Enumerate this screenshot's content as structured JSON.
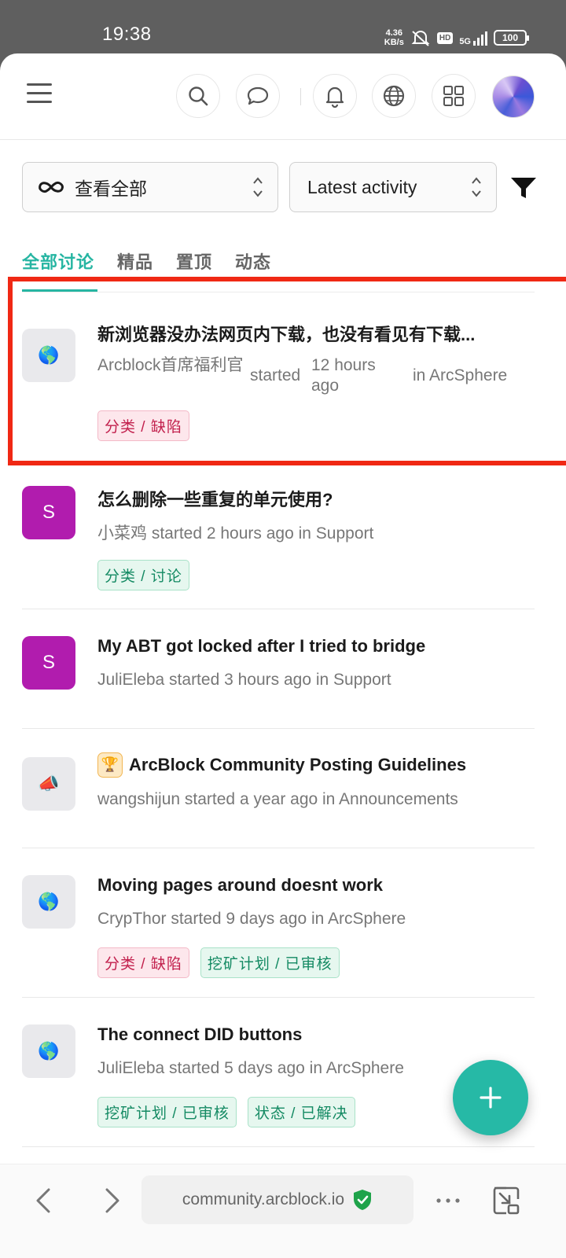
{
  "status_bar": {
    "time": "19:38",
    "net_speed_value": "4.36",
    "net_speed_unit": "KB/s",
    "hd": "HD",
    "network": "5G",
    "battery": "100"
  },
  "header": {
    "icons": [
      "menu-icon",
      "search-icon",
      "chat-icon",
      "bell-icon",
      "globe-icon",
      "apps-grid-icon",
      "user-avatar"
    ]
  },
  "filters": {
    "scope_label": "查看全部",
    "sort_label": "Latest activity"
  },
  "tabs": [
    {
      "label": "全部讨论",
      "active": true
    },
    {
      "label": "精品",
      "active": false
    },
    {
      "label": "置顶",
      "active": false
    },
    {
      "label": "动态",
      "active": false
    }
  ],
  "topics": [
    {
      "title": "新浏览器没办法网页内下载，也没有看见有下载...",
      "author": "Arcblock首席福利官",
      "verb": "started",
      "time": "12 hours ago",
      "board": "in ArcSphere",
      "avatar_icon": "globe-emoji-icon",
      "tags": [
        {
          "label": "分类 / 缺陷",
          "color": "red"
        }
      ]
    },
    {
      "title": "怎么删除一些重复的单元使用?",
      "meta": "小菜鸡 started 2 hours ago in Support",
      "avatar_letter": "S",
      "tags": [
        {
          "label": "分类 / 讨论",
          "color": "green"
        }
      ]
    },
    {
      "title": "My ABT got locked after I tried to bridge",
      "meta": "JuliEleba started 3 hours ago in Support",
      "avatar_letter": "S",
      "tags": []
    },
    {
      "title": "ArcBlock Community Posting Guidelines",
      "meta": "wangshijun started a year ago in Announcements",
      "avatar_icon": "megaphone-icon",
      "badge_icon": "trophy-icon",
      "tags": []
    },
    {
      "title": "Moving pages around doesnt work",
      "meta": "CrypThor started 9 days ago in ArcSphere",
      "avatar_icon": "globe-emoji-icon",
      "tags": [
        {
          "label": "分类 / 缺陷",
          "color": "red"
        },
        {
          "label": "挖矿计划 / 已审核",
          "color": "green"
        }
      ]
    },
    {
      "title": "The connect DID buttons",
      "meta": "JuliEleba started 5 days ago in ArcSphere",
      "avatar_icon": "globe-emoji-icon",
      "tags": [
        {
          "label": "挖矿计划 / 已审核",
          "color": "green"
        },
        {
          "label": "状态 / 已解决",
          "color": "green"
        }
      ]
    }
  ],
  "fab": {
    "icon": "plus-icon"
  },
  "browser": {
    "url": "community.arcblock.io",
    "icons": [
      "back-icon",
      "forward-icon",
      "shield-check-icon",
      "more-icon",
      "exit-fullscreen-icon"
    ]
  },
  "colors": {
    "accent": "#26b5a2",
    "highlight": "#f02814",
    "purple_avatar": "#b11cae"
  }
}
